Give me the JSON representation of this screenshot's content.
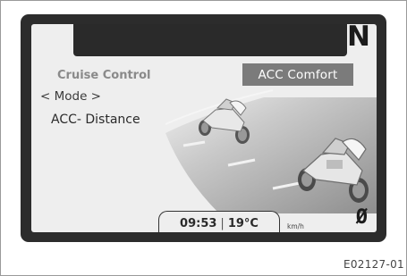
{
  "display": {
    "gear_indicator": "N",
    "title": "Cruise Control",
    "mode_badge": "ACC Comfort",
    "mode_selector": "< Mode >",
    "setting_label": "ACC- Distance",
    "status_bar": {
      "time": "09:53",
      "separator": "|",
      "temperature": "19°C",
      "speed_unit": "km/h"
    },
    "bottom_right_symbol": "Ø"
  },
  "figure_code": "E02127-01",
  "colors": {
    "bezel": "#2c2c2c",
    "screen_background": "#eeeeee",
    "badge_background": "#7b7b7b"
  },
  "icons": [
    "motorcycle-leading-icon",
    "motorcycle-following-icon"
  ]
}
